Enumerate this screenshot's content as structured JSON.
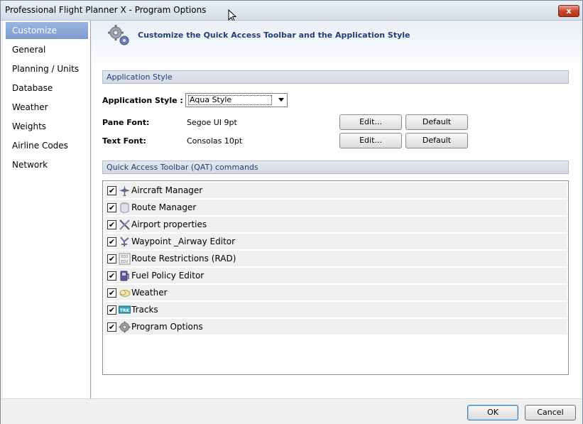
{
  "window": {
    "title": "Professional Flight Planner X - Program Options",
    "close_label": "x"
  },
  "sidebar": {
    "items": [
      {
        "label": "Customize",
        "active": true
      },
      {
        "label": "General"
      },
      {
        "label": "Planning / Units"
      },
      {
        "label": "Database"
      },
      {
        "label": "Weather"
      },
      {
        "label": "Weights"
      },
      {
        "label": "Airline Codes"
      },
      {
        "label": "Network"
      }
    ]
  },
  "header": {
    "title": "Customize the Quick Access Toolbar and the Application Style",
    "icon": "gear-icon"
  },
  "app_style": {
    "section_title": "Application Style",
    "style_label": "Application Style :",
    "style_value": "Aqua Style",
    "pane_font_label": "Pane Font:",
    "pane_font_value": "Segoe UI  9pt",
    "text_font_label": "Text Font:",
    "text_font_value": "Consolas  10pt",
    "edit_label": "Edit...",
    "default_label": "Default"
  },
  "qat": {
    "section_title": "Quick Access Toolbar (QAT) commands",
    "items": [
      {
        "label": "Aircraft Manager",
        "checked": true,
        "icon": "airplane-icon",
        "color": "#5b6b8a"
      },
      {
        "label": "Route Manager",
        "checked": true,
        "icon": "database-icon",
        "color": "#8a94a8"
      },
      {
        "label": "Airport properties",
        "checked": true,
        "icon": "tools-icon",
        "color": "#4a5a7a"
      },
      {
        "label": "Waypoint _Airway Editor",
        "checked": true,
        "icon": "waypoint-icon",
        "color": "#6a6a9a"
      },
      {
        "label": "Route Restrictions (RAD)",
        "checked": true,
        "icon": "rad-icon",
        "color": "#707070"
      },
      {
        "label": "Fuel Policy Editor",
        "checked": true,
        "icon": "fuel-icon",
        "color": "#4a4a8a"
      },
      {
        "label": "Weather",
        "checked": true,
        "icon": "cloud-icon",
        "color": "#c8c060"
      },
      {
        "label": "Tracks",
        "checked": true,
        "icon": "tracks-icon",
        "color": "#3aa0c0"
      },
      {
        "label": "Program Options",
        "checked": true,
        "icon": "gear-icon",
        "color": "#808080"
      }
    ],
    "check_mark": "✔",
    "tracks_badge": "TRK",
    "rad_badge_top": "ED2",
    "rad_badge_bottom": "ED2"
  },
  "footer": {
    "ok_label": "OK",
    "cancel_label": "Cancel"
  }
}
